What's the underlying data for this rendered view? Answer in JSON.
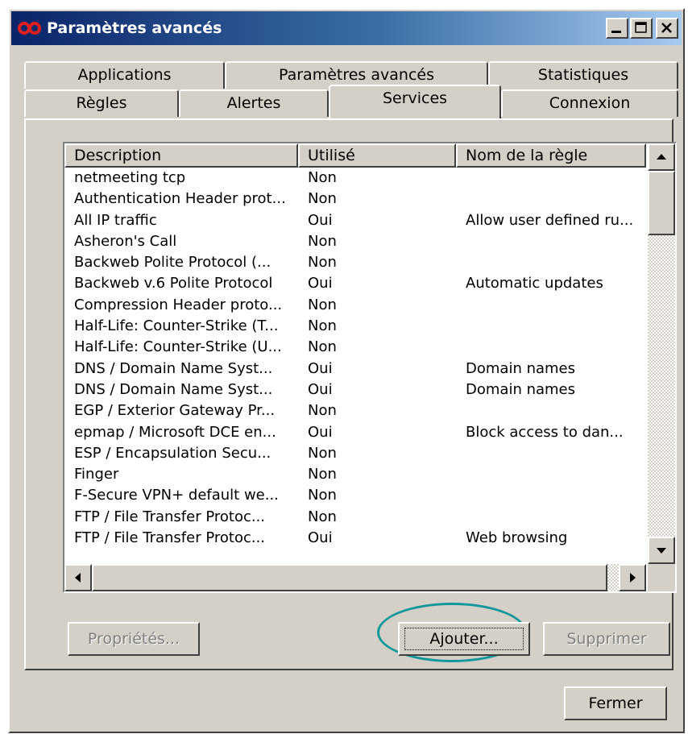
{
  "window": {
    "title": "Paramètres avancés",
    "icon": "infinity-icon",
    "controls": [
      "minimize-icon",
      "maximize-icon",
      "close-icon"
    ]
  },
  "tabs": {
    "row_back": [
      "Applications",
      "Paramètres avancés",
      "Statistiques"
    ],
    "row_front": [
      "Règles",
      "Alertes",
      "Services",
      "Connexion"
    ],
    "active": "Services"
  },
  "list": {
    "columns": [
      "Description",
      "Utilisé",
      "Nom de la règle"
    ],
    "rows": [
      [
        "netmeeting tcp",
        "Non",
        ""
      ],
      [
        "Authentication Header prot...",
        "Non",
        ""
      ],
      [
        "All IP traffic",
        "Oui",
        "Allow user defined ru..."
      ],
      [
        "Asheron's Call",
        "Non",
        ""
      ],
      [
        "Backweb Polite Protocol (...",
        "Non",
        ""
      ],
      [
        "Backweb v.6 Polite Protocol",
        "Oui",
        "Automatic updates"
      ],
      [
        "Compression Header proto...",
        "Non",
        ""
      ],
      [
        "Half-Life: Counter-Strike (T...",
        "Non",
        ""
      ],
      [
        "Half-Life: Counter-Strike (U...",
        "Non",
        ""
      ],
      [
        "DNS / Domain Name Syst...",
        "Oui",
        "Domain names"
      ],
      [
        "DNS / Domain Name Syst...",
        "Oui",
        "Domain names"
      ],
      [
        "EGP / Exterior Gateway Pr...",
        "Non",
        ""
      ],
      [
        "epmap / Microsoft DCE en...",
        "Oui",
        "Block access to dan..."
      ],
      [
        "ESP / Encapsulation Secu...",
        "Non",
        ""
      ],
      [
        "Finger",
        "Non",
        ""
      ],
      [
        "F-Secure VPN+ default we...",
        "Non",
        ""
      ],
      [
        "FTP / File Transfer Protoc...",
        "Non",
        ""
      ],
      [
        "FTP / File Transfer Protoc...",
        "Oui",
        "Web browsing"
      ]
    ]
  },
  "buttons": {
    "properties": "Propriétés...",
    "add": "Ajouter...",
    "remove": "Supprimer",
    "close": "Fermer"
  },
  "colors": {
    "title_start": "#0a246a",
    "title_end": "#a6caf0",
    "dialog_face": "#d4d0c8",
    "highlight_ring": "#11979b",
    "icon_red": "#e02020"
  }
}
